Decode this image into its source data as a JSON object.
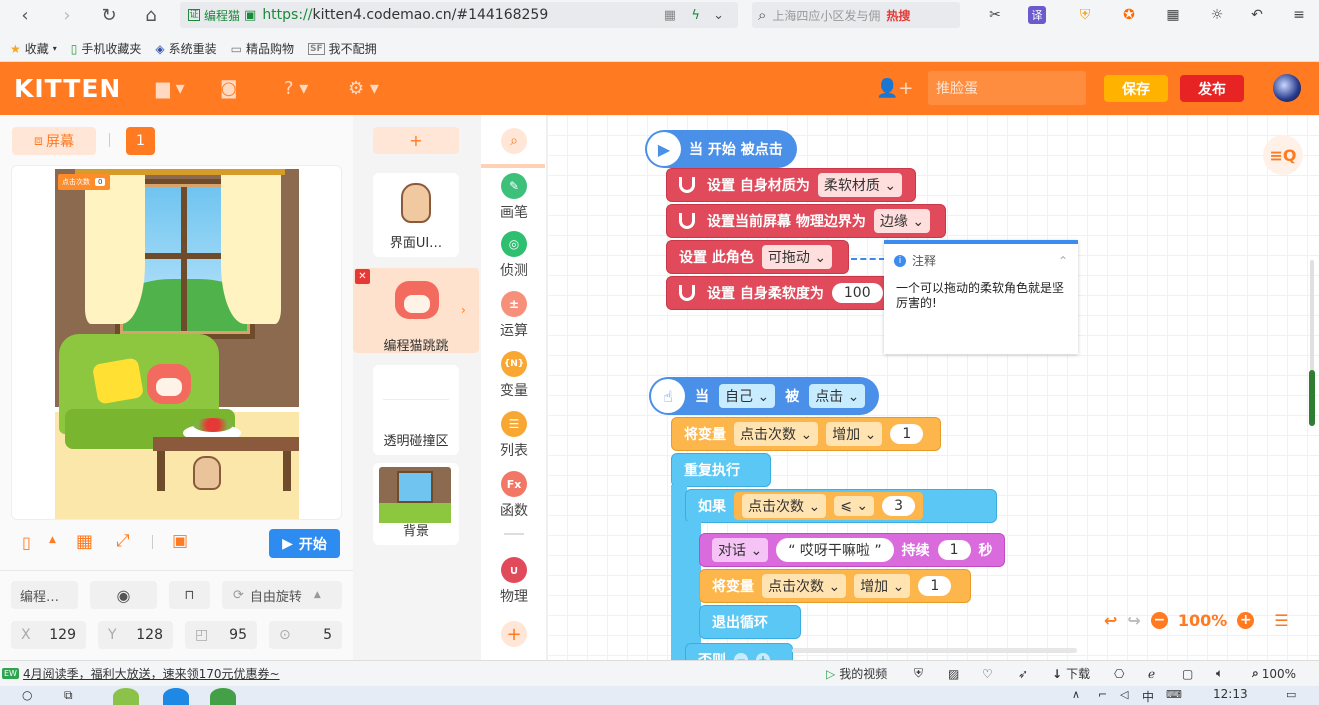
{
  "browser": {
    "site_name": "编程猫",
    "url_prefix": "https://",
    "url_rest": "kitten4.codemao.cn/#144168259",
    "search_placeholder": "上海四应小区发与佣",
    "search_hot": "热搜",
    "bookmarks": [
      "收藏",
      "手机收藏夹",
      "系统重装",
      "精品购物",
      "我不配拥"
    ]
  },
  "app": {
    "logo": "KITTEN",
    "project_name": "推脸蛋",
    "save": "保存",
    "publish": "发布",
    "accent": "#ff7a21"
  },
  "stage": {
    "screen_tab": "屏幕",
    "screen_count": "1",
    "counter_label": "点击次数",
    "counter_value": "0",
    "start": "开始"
  },
  "props": {
    "name": "编程…",
    "rotation": "自由旋转",
    "x_label": "X",
    "x": "129",
    "y_label": "Y",
    "y": "128",
    "size": "95",
    "direction": "5"
  },
  "sprites": {
    "add": "+",
    "items": [
      "界面UI…",
      "编程猫跳跳",
      "透明碰撞区",
      "背景"
    ]
  },
  "categories": [
    {
      "label": "画笔",
      "icon": "pen-icon",
      "color": "#3cc07a"
    },
    {
      "label": "侦测",
      "icon": "detect-icon",
      "color": "#2fbf71"
    },
    {
      "label": "运算",
      "icon": "math-icon",
      "color": "#f7907b"
    },
    {
      "label": "变量",
      "icon": "variable-icon",
      "color": "#f8a832",
      "glyph": "{N}"
    },
    {
      "label": "列表",
      "icon": "list-icon",
      "color": "#f8a832"
    },
    {
      "label": "函数",
      "icon": "function-icon",
      "color": "#f27766",
      "glyph": "Fx"
    },
    {
      "label": "物理",
      "icon": "physics-icon",
      "color": "#e04a5a"
    }
  ],
  "script1": {
    "hat": "当 开始 被点击",
    "b1_label": "设置 自身材质为",
    "b1_value": "柔软材质",
    "b2_label": "设置当前屏幕 物理边界为",
    "b2_value": "边缘",
    "b3_label": "设置 此角色",
    "b3_value": "可拖动",
    "b4_label": "设置 自身柔软度为",
    "b4_value": "100"
  },
  "note": {
    "title": "注释",
    "text": "一个可以拖动的柔软角色就是坚厉害的!"
  },
  "script2": {
    "hat_when": "当",
    "hat_target": "自己",
    "hat_by": "被",
    "hat_event": "点击",
    "var1_label": "将变量",
    "var1_name": "点击次数",
    "var1_op": "增加",
    "var1_value": "1",
    "repeat": "重复执行",
    "if": "如果",
    "cond_var": "点击次数",
    "cond_op": "⩽",
    "cond_value": "3",
    "say": "对话",
    "say_text": "“ 哎呀干嘛啦 ”",
    "say_for": "持续",
    "say_secs": "1",
    "say_unit": "秒",
    "var2_label": "将变量",
    "var2_name": "点击次数",
    "var2_op": "增加",
    "var2_value": "1",
    "break": "退出循环",
    "else": "否则"
  },
  "zoom": "100%",
  "status": {
    "left_text": "4月阅读季，福利大放送，速来领170元优惠券~",
    "my_video": "我的视频",
    "download": "下载",
    "zoom": "100%"
  },
  "taskbar": {
    "time": "12:13",
    "ime": "中"
  }
}
